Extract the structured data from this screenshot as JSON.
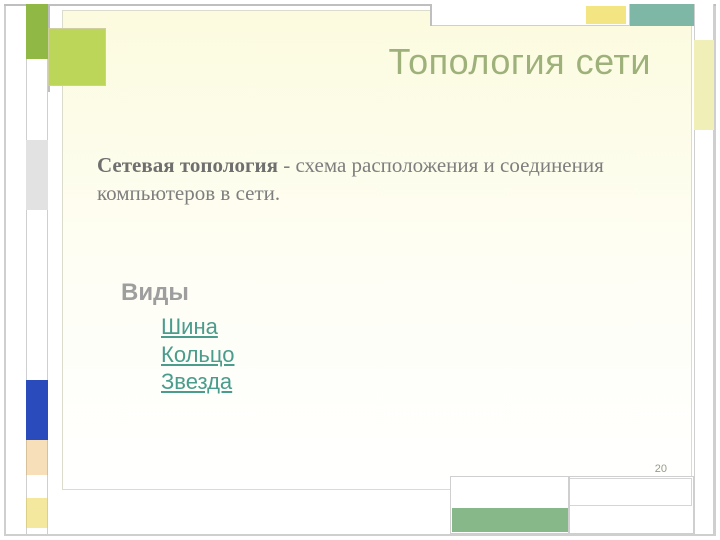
{
  "title": "Топология сети",
  "definition_bold": "Сетевая топология",
  "definition_rest": " - схема расположения и соединения компьютеров в сети.",
  "kinds_label": "Виды",
  "kinds": [
    "Шина",
    "Кольцо",
    "Звезда"
  ],
  "page_number": "20"
}
